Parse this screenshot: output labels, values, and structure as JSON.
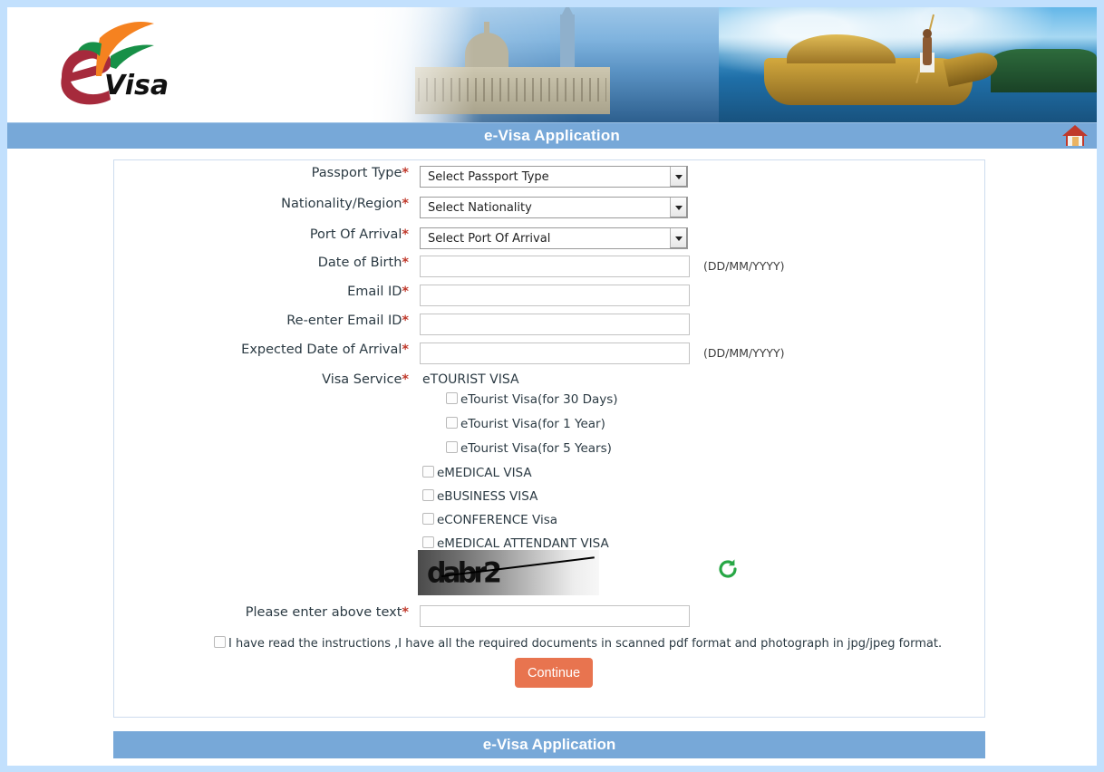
{
  "header": {
    "logo_alt": "e-Visa",
    "logo_e": "e",
    "logo_visa": "Visa",
    "title": "e-Visa Application",
    "home_icon": "home-icon"
  },
  "form": {
    "rows": [
      {
        "label": "Passport Type",
        "required": "*",
        "control": "select",
        "value": "Select Passport Type",
        "hint": ""
      },
      {
        "label": "Nationality/Region",
        "required": "*",
        "control": "select",
        "value": "Select Nationality",
        "hint": ""
      },
      {
        "label": "Port Of Arrival",
        "required": "*",
        "control": "select",
        "value": "Select Port Of Arrival",
        "hint": ""
      },
      {
        "label": "Date of Birth",
        "required": "*",
        "control": "text",
        "value": "",
        "placeholder": "",
        "hint": "(DD/MM/YYYY)"
      },
      {
        "label": "Email ID",
        "required": "*",
        "control": "text",
        "value": "",
        "placeholder": "",
        "hint": ""
      },
      {
        "label": "Re-enter Email ID",
        "required": "*",
        "control": "text",
        "value": "",
        "placeholder": "",
        "hint": ""
      },
      {
        "label": "Expected Date of Arrival",
        "required": "*",
        "control": "text",
        "value": "",
        "placeholder": "",
        "hint": "(DD/MM/YYYY)"
      }
    ],
    "visa_service": {
      "label": "Visa Service",
      "required": "*",
      "group_heading": "eTOURIST VISA",
      "sub_options": [
        {
          "label": "eTourist Visa(for 30 Days)",
          "checked": false
        },
        {
          "label": "eTourist Visa(for 1 Year)",
          "checked": false
        },
        {
          "label": "eTourist Visa(for 5 Years)",
          "checked": false
        }
      ],
      "options": [
        {
          "label": "eMEDICAL VISA",
          "checked": false
        },
        {
          "label": "eBUSINESS VISA",
          "checked": false
        },
        {
          "label": "eCONFERENCE Visa",
          "checked": false
        },
        {
          "label": "eMEDICAL ATTENDANT VISA",
          "checked": false
        }
      ]
    },
    "captcha": {
      "text": "dabr2",
      "refresh_icon": "refresh-icon"
    },
    "captcha_field": {
      "label": "Please enter above text",
      "required": "*",
      "value": "",
      "placeholder": ""
    },
    "terms": {
      "label": "I have read the instructions ,I have all the required documents in scanned pdf format and photograph in jpg/jpeg format.",
      "checked": false
    },
    "submit_label": "Continue"
  },
  "footer": {
    "title": "e-Visa Application"
  },
  "colors": {
    "bar_blue": "#77a8d8",
    "page_bg": "#c2e0fd",
    "required_red": "#c0392b",
    "continue_orange": "#e8744f",
    "refresh_green": "#27a745",
    "logo_maroon": "#a62a3c",
    "logo_saffron": "#f58220",
    "logo_green": "#179047"
  }
}
